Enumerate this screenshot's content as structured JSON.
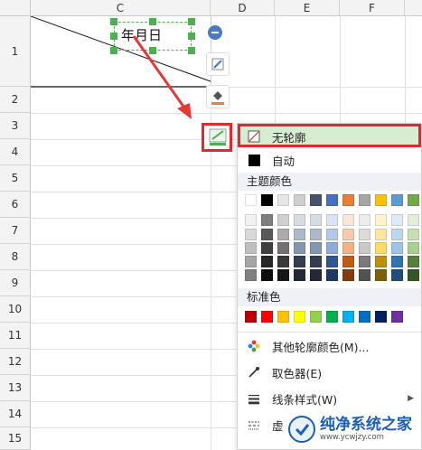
{
  "spreadsheet": {
    "columns": [
      "C",
      "D",
      "E",
      "F"
    ],
    "rows": [
      "1",
      "2",
      "3",
      "4",
      "5",
      "6",
      "7",
      "8",
      "9",
      "10",
      "11",
      "12",
      "13",
      "14",
      "15"
    ],
    "cell_text": "年月日"
  },
  "menu": {
    "no_outline": "无轮廓",
    "automatic": "自动",
    "theme_colors_title": "主题颜色",
    "standard_colors_title": "标准色",
    "more_colors": "其他轮廓颜色(M)...",
    "eyedropper": "取色器(E)",
    "line_style": "线条样式(W)",
    "dash_style_partial": "虚"
  },
  "colors": {
    "accent_red": "#e0282e",
    "highlight_green": "#d7ecd0",
    "theme_row": [
      "#ffffff",
      "#000000",
      "#e7e6e6",
      "#d0cece",
      "#44546a",
      "#4472c4",
      "#ed7d31",
      "#a5a5a5",
      "#ffc000",
      "#5b9bd5",
      "#70ad47"
    ],
    "standard_row": [
      "#c00000",
      "#ff0000",
      "#ffc000",
      "#ffff00",
      "#92d050",
      "#00b050",
      "#00b0f0",
      "#0070c0",
      "#002060",
      "#7030a0"
    ]
  },
  "watermark": {
    "title": "纯净系统之家",
    "url": "www.ycwjzy.com"
  }
}
